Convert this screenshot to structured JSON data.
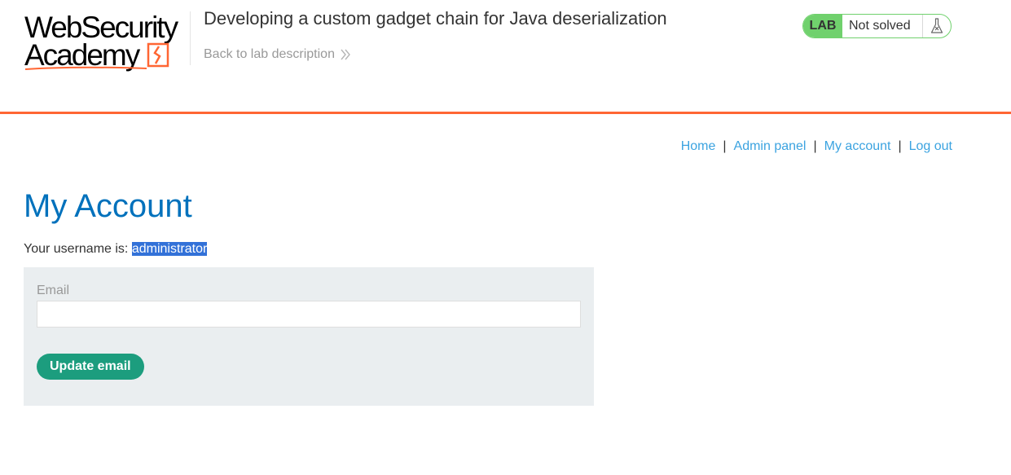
{
  "header": {
    "logo": {
      "line1": "WebSecurity",
      "line2": "Academy",
      "accent_color": "#ff6633"
    },
    "lab_title": "Developing a custom gadget chain for Java deserialization",
    "back_link": "Back to lab description",
    "status": {
      "tag": "LAB",
      "text": "Not solved",
      "icon": "flask-icon",
      "tag_color": "#70d16d"
    }
  },
  "nav": {
    "items": [
      "Home",
      "Admin panel",
      "My account",
      "Log out"
    ],
    "separator": "|"
  },
  "main": {
    "title": "My Account",
    "username_label": "Your username is: ",
    "username_value": "administrator",
    "form": {
      "email_label": "Email",
      "email_value": "",
      "submit_label": "Update email"
    }
  },
  "colors": {
    "accent": "#ff6633",
    "link": "#3ba3e0",
    "title": "#0071bc",
    "button": "#1c9d7e",
    "panel": "#eaeef0"
  }
}
